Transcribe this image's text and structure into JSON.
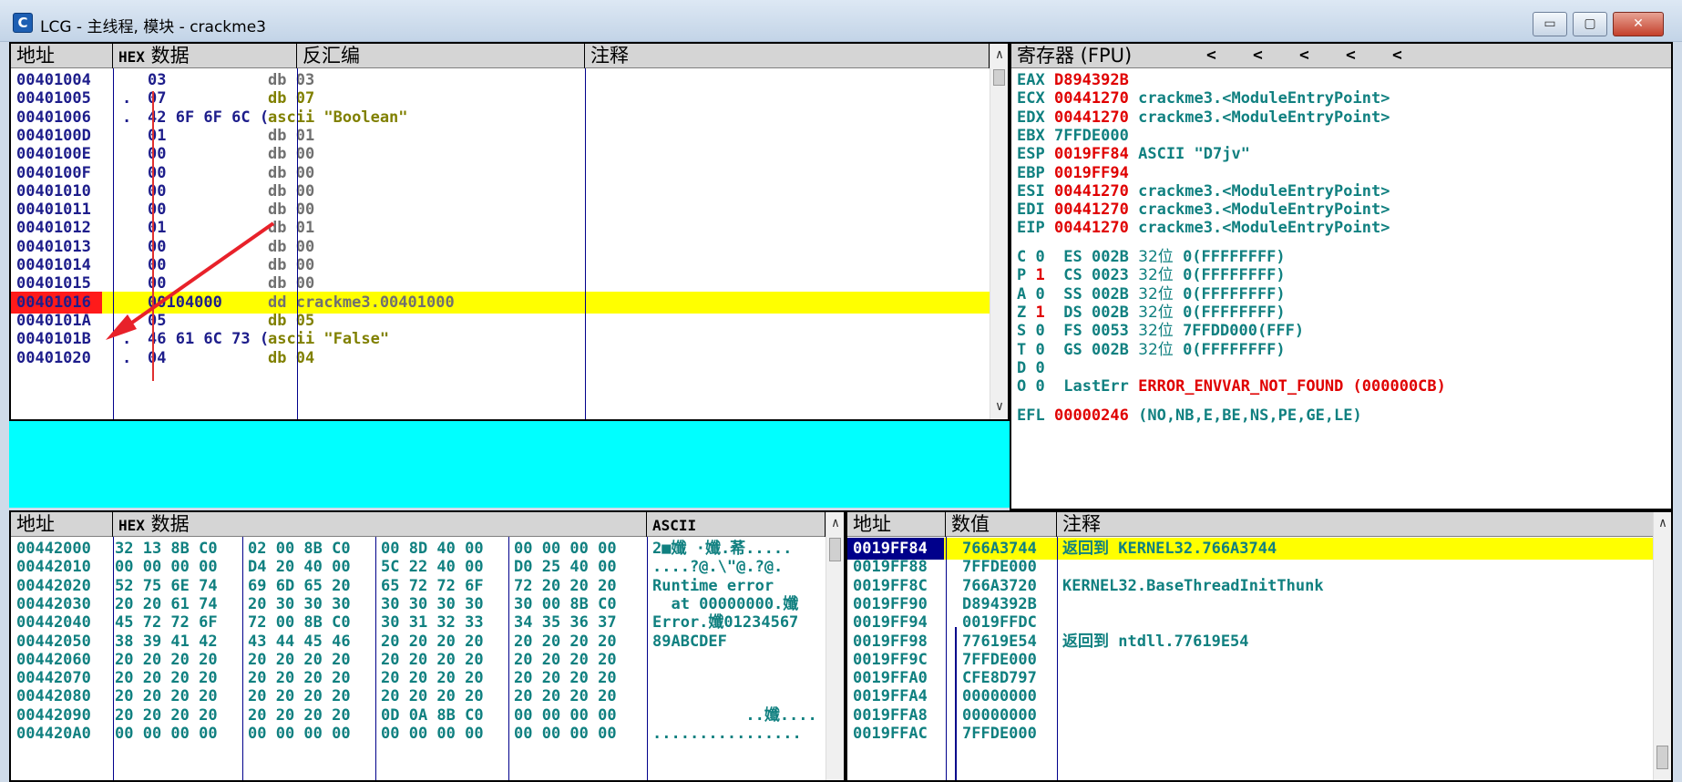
{
  "window": {
    "title": "LCG - 主线程, 模块 - crackme3",
    "icon_letter": "C",
    "min_label": "▭",
    "max_label": "▢",
    "close_label": "✕"
  },
  "disasm": {
    "headers": {
      "address": "地址",
      "hex_prefix": "HEX",
      "hex": "数据",
      "disasm": "反汇编",
      "comment": "注释"
    },
    "rows": [
      {
        "addr": "00401004",
        "mark": "",
        "hex": "03",
        "asm": "db 03",
        "style": "gray"
      },
      {
        "addr": "00401005",
        "mark": ".",
        "hex": "07",
        "asm": "db 07",
        "style": "olive"
      },
      {
        "addr": "00401006",
        "mark": ".",
        "hex": "42 6F 6F 6C (",
        "asm": "ascii \"Boolean\"",
        "style": "olive"
      },
      {
        "addr": "0040100D",
        "mark": "",
        "hex": "01",
        "asm": "db 01",
        "style": "gray"
      },
      {
        "addr": "0040100E",
        "mark": "",
        "hex": "00",
        "asm": "db 00",
        "style": "gray"
      },
      {
        "addr": "0040100F",
        "mark": "",
        "hex": "00",
        "asm": "db 00",
        "style": "gray"
      },
      {
        "addr": "00401010",
        "mark": "",
        "hex": "00",
        "asm": "db 00",
        "style": "gray"
      },
      {
        "addr": "00401011",
        "mark": "",
        "hex": "00",
        "asm": "db 00",
        "style": "gray"
      },
      {
        "addr": "00401012",
        "mark": "",
        "hex": "01",
        "asm": "db 01",
        "style": "gray"
      },
      {
        "addr": "00401013",
        "mark": "",
        "hex": "00",
        "asm": "db 00",
        "style": "gray"
      },
      {
        "addr": "00401014",
        "mark": "",
        "hex": "00",
        "asm": "db 00",
        "style": "gray"
      },
      {
        "addr": "00401015",
        "mark": "",
        "hex": "00",
        "asm": "db 00",
        "style": "gray"
      },
      {
        "addr": "00401016",
        "mark": "",
        "hex": "00104000",
        "asm": "dd crackme3.00401000",
        "style": "gray",
        "selected": true
      },
      {
        "addr": "0040101A",
        "mark": ".",
        "hex": "05",
        "asm": "db 05",
        "style": "olive"
      },
      {
        "addr": "0040101B",
        "mark": ".",
        "hex": "46 61 6C 73 (",
        "asm": "ascii \"False\"",
        "style": "olive"
      },
      {
        "addr": "00401020",
        "mark": ".",
        "hex": "04",
        "asm": "db 04",
        "style": "olive"
      }
    ]
  },
  "registers": {
    "header": "寄存器 (FPU)",
    "nav_arrows": [
      "<",
      "<",
      "<",
      "<",
      "<"
    ],
    "rows": [
      {
        "name": "EAX",
        "value": "D894392B",
        "desc": ""
      },
      {
        "name": "ECX",
        "value": "00441270",
        "desc": "crackme3.<ModuleEntryPoint>"
      },
      {
        "name": "EDX",
        "value": "00441270",
        "desc": "crackme3.<ModuleEntryPoint>"
      },
      {
        "name": "EBX",
        "value": "7FFDE000",
        "desc": "",
        "plain": true
      },
      {
        "name": "ESP",
        "value": "0019FF84",
        "desc": "ASCII \"D7jv\""
      },
      {
        "name": "EBP",
        "value": "0019FF94",
        "desc": ""
      },
      {
        "name": "ESI",
        "value": "00441270",
        "desc": "crackme3.<ModuleEntryPoint>"
      },
      {
        "name": "EDI",
        "value": "00441270",
        "desc": "crackme3.<ModuleEntryPoint>"
      }
    ],
    "eip": {
      "name": "EIP",
      "value": "00441270",
      "desc": "crackme3.<ModuleEntryPoint>"
    },
    "flags": [
      {
        "f": "C",
        "v": "0",
        "seg": "ES",
        "sel": "002B",
        "bits": "32位",
        "base": "0(FFFFFFFF)"
      },
      {
        "f": "P",
        "v": "1",
        "seg": "CS",
        "sel": "0023",
        "bits": "32位",
        "base": "0(FFFFFFFF)"
      },
      {
        "f": "A",
        "v": "0",
        "seg": "SS",
        "sel": "002B",
        "bits": "32位",
        "base": "0(FFFFFFFF)"
      },
      {
        "f": "Z",
        "v": "1",
        "seg": "DS",
        "sel": "002B",
        "bits": "32位",
        "base": "0(FFFFFFFF)"
      },
      {
        "f": "S",
        "v": "0",
        "seg": "FS",
        "sel": "0053",
        "bits": "32位",
        "base": "7FFDD000(FFF)"
      },
      {
        "f": "T",
        "v": "0",
        "seg": "GS",
        "sel": "002B",
        "bits": "32位",
        "base": "0(FFFFFFFF)"
      }
    ],
    "flag_d": {
      "f": "D",
      "v": "0"
    },
    "flag_o": {
      "f": "O",
      "v": "0",
      "label": "LastErr",
      "err": "ERROR_ENVVAR_NOT_FOUND (000000CB)"
    },
    "efl": {
      "name": "EFL",
      "value": "00000246",
      "desc": "(NO,NB,E,BE,NS,PE,GE,LE)"
    }
  },
  "dump": {
    "headers": {
      "address": "地址",
      "hex_prefix": "HEX",
      "hex": "数据",
      "ascii": "ASCII"
    },
    "rows": [
      {
        "addr": "00442000",
        "b": [
          "32 13 8B C0",
          "02 00 8B C0",
          "00 8D 40 00",
          "00 00 00 00"
        ],
        "ascii": "2■孅 ·孅.莃....."
      },
      {
        "addr": "00442010",
        "b": [
          "00 00 00 00",
          "D4 20 40 00",
          "5C 22 40 00",
          "D0 25 40 00"
        ],
        "ascii": "....?@.\\\"@.?@."
      },
      {
        "addr": "00442020",
        "b": [
          "52 75 6E 74",
          "69 6D 65 20",
          "65 72 72 6F",
          "72 20 20 20"
        ],
        "ascii": "Runtime error"
      },
      {
        "addr": "00442030",
        "b": [
          "20 20 61 74",
          "20 30 30 30",
          "30 30 30 30",
          "30 00 8B C0"
        ],
        "ascii": "  at 00000000.孅"
      },
      {
        "addr": "00442040",
        "b": [
          "45 72 72 6F",
          "72 00 8B C0",
          "30 31 32 33",
          "34 35 36 37"
        ],
        "ascii": "Error.孅01234567"
      },
      {
        "addr": "00442050",
        "b": [
          "38 39 41 42",
          "43 44 45 46",
          "20 20 20 20",
          "20 20 20 20"
        ],
        "ascii": "89ABCDEF"
      },
      {
        "addr": "00442060",
        "b": [
          "20 20 20 20",
          "20 20 20 20",
          "20 20 20 20",
          "20 20 20 20"
        ],
        "ascii": ""
      },
      {
        "addr": "00442070",
        "b": [
          "20 20 20 20",
          "20 20 20 20",
          "20 20 20 20",
          "20 20 20 20"
        ],
        "ascii": ""
      },
      {
        "addr": "00442080",
        "b": [
          "20 20 20 20",
          "20 20 20 20",
          "20 20 20 20",
          "20 20 20 20"
        ],
        "ascii": ""
      },
      {
        "addr": "00442090",
        "b": [
          "20 20 20 20",
          "20 20 20 20",
          "0D 0A 8B C0",
          "00 00 00 00"
        ],
        "ascii": "          ..孅...."
      },
      {
        "addr": "004420A0",
        "b": [
          "00 00 00 00",
          "00 00 00 00",
          "00 00 00 00",
          "00 00 00 00"
        ],
        "ascii": "................"
      }
    ]
  },
  "stack": {
    "headers": {
      "address": "地址",
      "value": "数值",
      "comment": "注释"
    },
    "rows": [
      {
        "addr": "0019FF84",
        "value": "766A3744",
        "comment": "返回到 KERNEL32.766A3744",
        "selected": true
      },
      {
        "addr": "0019FF88",
        "value": "7FFDE000",
        "comment": ""
      },
      {
        "addr": "0019FF8C",
        "value": "766A3720",
        "comment": "KERNEL32.BaseThreadInitThunk"
      },
      {
        "addr": "0019FF90",
        "value": "D894392B",
        "comment": ""
      },
      {
        "addr": "0019FF94",
        "value": "0019FFDC",
        "comment": "",
        "bracket": "┌"
      },
      {
        "addr": "0019FF98",
        "value": "77619E54",
        "comment": "返回到 ntdll.77619E54"
      },
      {
        "addr": "0019FF9C",
        "value": "7FFDE000",
        "comment": ""
      },
      {
        "addr": "0019FFA0",
        "value": "CFE8D797",
        "comment": ""
      },
      {
        "addr": "0019FFA4",
        "value": "00000000",
        "comment": ""
      },
      {
        "addr": "0019FFA8",
        "value": "00000000",
        "comment": ""
      },
      {
        "addr": "0019FFAC",
        "value": "7FFDE000",
        "comment": ""
      }
    ]
  },
  "scroll": {
    "up": "∧",
    "down": "∨"
  },
  "colors": {
    "selection": "#ffff00",
    "eip_row": "#ff1a1a",
    "cyan": "#00ffff",
    "arrow": "#e8212a"
  }
}
